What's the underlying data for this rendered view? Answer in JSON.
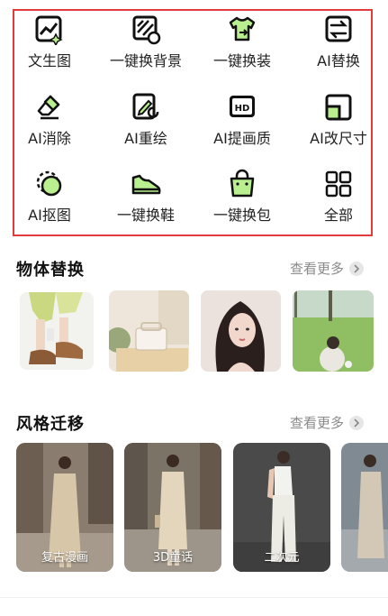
{
  "tools": [
    {
      "label": "文生图",
      "icon": "text-to-image-icon"
    },
    {
      "label": "一键换背景",
      "icon": "swap-background-icon"
    },
    {
      "label": "一键换装",
      "icon": "swap-outfit-icon"
    },
    {
      "label": "AI替换",
      "icon": "ai-replace-icon"
    },
    {
      "label": "AI消除",
      "icon": "eraser-icon"
    },
    {
      "label": "AI重绘",
      "icon": "redraw-icon"
    },
    {
      "label": "AI提画质",
      "icon": "hd-icon"
    },
    {
      "label": "AI改尺寸",
      "icon": "resize-icon"
    },
    {
      "label": "AI抠图",
      "icon": "cutout-icon"
    },
    {
      "label": "一键换鞋",
      "icon": "shoe-icon"
    },
    {
      "label": "一键换包",
      "icon": "bag-icon"
    },
    {
      "label": "全部",
      "icon": "grid-icon"
    }
  ],
  "sections": {
    "object_replace": {
      "title": "物体替换",
      "more": "查看更多"
    },
    "style_transfer": {
      "title": "风格迁移",
      "more": "查看更多"
    }
  },
  "style_cards": [
    {
      "caption": "复古漫画"
    },
    {
      "caption": "3D童话"
    },
    {
      "caption": "二次元"
    },
    {
      "caption": ""
    }
  ],
  "colors": {
    "accent": "#b9ef8f",
    "highlight_border": "#e23b3b",
    "muted_text": "#8a8a8a"
  }
}
